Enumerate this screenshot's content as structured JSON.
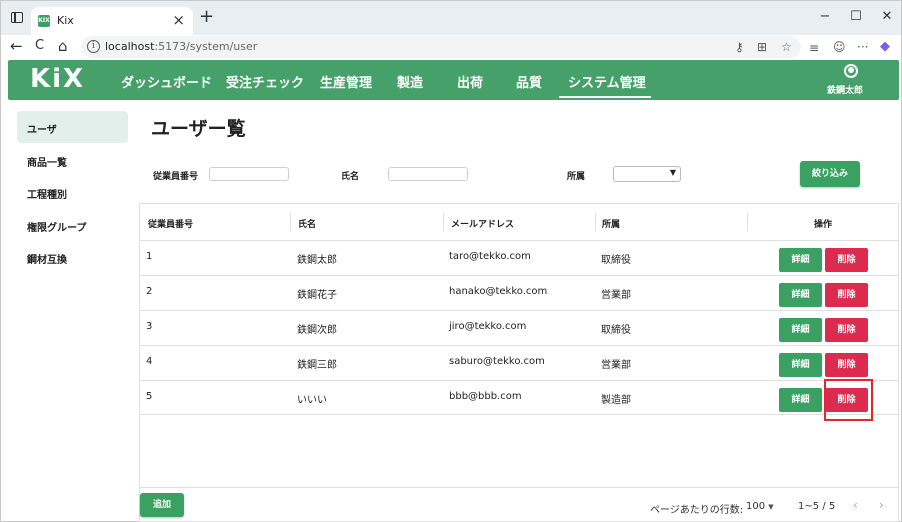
{
  "browser": {
    "tab_title": "Kix",
    "favicon_text": "KIX",
    "url_host": "localhost",
    "url_path": ":5173/system/user",
    "window_controls": {
      "minimize": "−",
      "maximize": "☐",
      "close": "✕"
    },
    "nav": {
      "back": "←",
      "reload": "C",
      "home": "⌂"
    }
  },
  "header": {
    "logo": "KiX",
    "nav_items": [
      "ダッシュボード",
      "受注チェック",
      "生産管理",
      "製造",
      "出荷",
      "品質",
      "システム管理"
    ],
    "active_nav": "システム管理",
    "user_name": "鉄鋼太郎"
  },
  "sidebar": {
    "items": [
      {
        "label": "ユーザ",
        "active": true
      },
      {
        "label": "商品一覧",
        "active": false
      },
      {
        "label": "工程種別",
        "active": false
      },
      {
        "label": "権限グループ",
        "active": false
      },
      {
        "label": "鋼材互換",
        "active": false
      }
    ]
  },
  "main": {
    "title": "ユーザー覧",
    "filters": {
      "employee_no_label": "従業員番号",
      "employee_no_value": "",
      "name_label": "氏名",
      "name_value": "",
      "department_label": "所属",
      "department_value": "",
      "submit_label": "絞り込み"
    },
    "table": {
      "columns": [
        "従業員番号",
        "氏名",
        "メールアドレス",
        "所属",
        "操作"
      ],
      "rows": [
        {
          "no": "1",
          "name": "鉄鋼太郎",
          "email": "taro@tekko.com",
          "dept": "取締役"
        },
        {
          "no": "2",
          "name": "鉄鋼花子",
          "email": "hanako@tekko.com",
          "dept": "営業部"
        },
        {
          "no": "3",
          "name": "鉄鋼次郎",
          "email": "jiro@tekko.com",
          "dept": "取締役"
        },
        {
          "no": "4",
          "name": "鉄鋼三郎",
          "email": "saburo@tekko.com",
          "dept": "営業部"
        },
        {
          "no": "5",
          "name": "いいい",
          "email": "bbb@bbb.com",
          "dept": "製造部"
        }
      ],
      "detail_label": "詳細",
      "delete_label": "削除"
    },
    "footer": {
      "add_label": "追加",
      "rows_per_page_label": "ページあたりの行数:",
      "rows_per_page_value": "100",
      "range": "1~5 / 5"
    }
  },
  "colors": {
    "brand_green": "#46a06a",
    "button_green": "#3aa163",
    "delete_red": "#dc2b4e",
    "highlight": "#e3252e"
  }
}
